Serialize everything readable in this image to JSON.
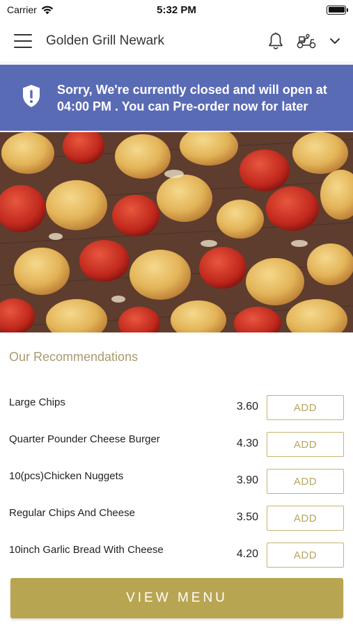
{
  "status_bar": {
    "carrier": "Carrier",
    "time": "5:32 PM"
  },
  "header": {
    "title": "Golden Grill Newark",
    "icons": [
      "hamburger-menu-icon",
      "bell-icon",
      "scooter-delivery-icon",
      "chevron-down-icon"
    ]
  },
  "banner": {
    "message": "Sorry, We're currently closed and will open at 04:00 PM . You can Pre-order now for later",
    "icon": "shield-alert-icon",
    "background": "#5a6bb5"
  },
  "hero": {
    "icon": "chicken-kebab-photo"
  },
  "recommendations": {
    "title": "Our Recommendations",
    "items": [
      {
        "name": "Large Chips",
        "price": "3.60",
        "add_label": "ADD"
      },
      {
        "name": "Quarter Pounder Cheese Burger",
        "price": "4.30",
        "add_label": "ADD"
      },
      {
        "name": "10(pcs)Chicken Nuggets",
        "price": "3.90",
        "add_label": "ADD"
      },
      {
        "name": "Regular Chips And Cheese",
        "price": "3.50",
        "add_label": "ADD"
      },
      {
        "name": "10inch Garlic Bread With Cheese",
        "price": "4.20",
        "add_label": "ADD"
      }
    ]
  },
  "footer": {
    "view_menu_label": "VIEW MENU",
    "accent": "#b8a552"
  }
}
